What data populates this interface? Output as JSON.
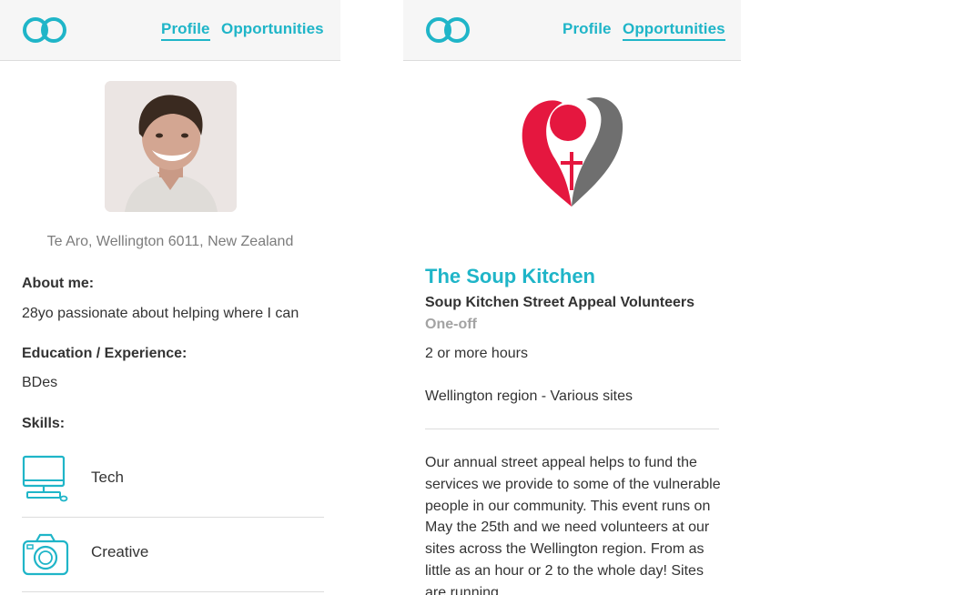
{
  "colors": {
    "accent": "#1fb5c8",
    "brand_red": "#e5173f",
    "brand_grey": "#6f6f6f"
  },
  "profile_screen": {
    "nav": {
      "profile": "Profile",
      "opportunities": "Opportunities",
      "active": "profile"
    },
    "location": "Te Aro, Wellington 6011, New Zealand",
    "about_label": "About me:",
    "about_text": "28yo passionate about helping where I can",
    "education_label": "Education / Experience:",
    "education_text": "BDes",
    "skills_label": "Skills:",
    "skills": [
      {
        "name": "Tech",
        "icon": "computer-icon"
      },
      {
        "name": "Creative",
        "icon": "camera-icon"
      }
    ]
  },
  "opportunity_screen": {
    "nav": {
      "profile": "Profile",
      "opportunities": "Opportunities",
      "active": "opportunities"
    },
    "org_name": "The Soup Kitchen",
    "title": "Soup Kitchen Street Appeal Volunteers",
    "type": "One-off",
    "duration": "2 or more hours",
    "location": "Wellington region - Various sites",
    "description": "Our annual street appeal helps to fund the services we provide to some of the vulnerable people in our community.  This event runs on May the 25th and we need volunteers at our sites across the Wellington region. From as little as an hour or 2 to the whole day! Sites are running"
  }
}
